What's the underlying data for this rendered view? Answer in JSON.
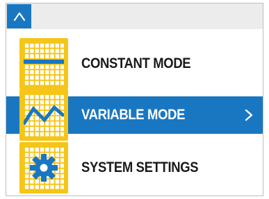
{
  "header": {
    "home_icon": "home-chevron-up-icon"
  },
  "menu": {
    "items": [
      {
        "label": "CONSTANT MODE",
        "icon": "constant-line-icon",
        "selected": false
      },
      {
        "label": "VARIABLE MODE",
        "icon": "variable-wave-icon",
        "selected": true,
        "trailing_icon": "chevron-right-icon"
      },
      {
        "label": "SYSTEM SETTINGS",
        "icon": "gear-icon",
        "selected": false
      }
    ]
  },
  "colors": {
    "accent_blue": "#1977c2",
    "tile_yellow": "#f5c518",
    "topbar_gray": "#ececec",
    "text_dark": "#1a1a1a",
    "text_selected": "#ffffff"
  }
}
